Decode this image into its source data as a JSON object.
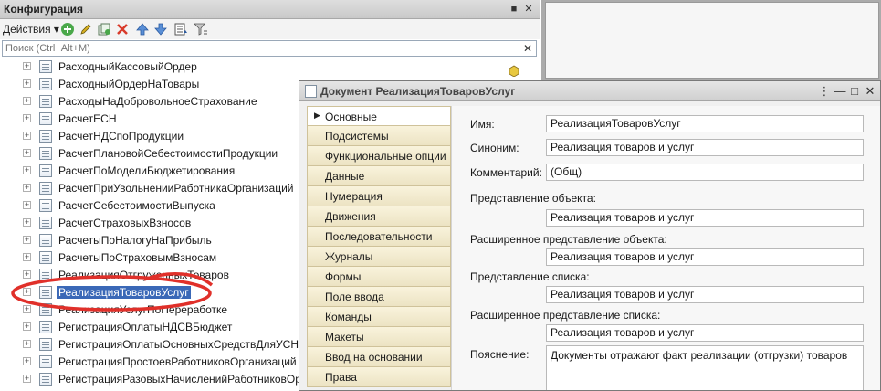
{
  "config_panel": {
    "title": "Конфигурация",
    "pin_icon": "pin-icon",
    "close_icon": "close-icon",
    "toolbar": {
      "actions_label": "Действия",
      "icons": [
        "add-icon",
        "edit-icon",
        "copy-icon",
        "delete-icon",
        "move-up-icon",
        "move-down-icon",
        "sort-icon",
        "filter-icon"
      ]
    },
    "search": {
      "placeholder": "Поиск (Ctrl+Alt+M)"
    },
    "tree_items": [
      "РасходныйКассовыйОрдер",
      "РасходныйОрдерНаТовары",
      "РасходыНаДобровольноеСтрахование",
      "РасчетЕСН",
      "РасчетНДСпоПродукции",
      "РасчетПлановойСебестоимостиПродукции",
      "РасчетПоМоделиБюджетирования",
      "РасчетПриУвольненииРаботникаОрганизаций",
      "РасчетСебестоимостиВыпуска",
      "РасчетСтраховыхВзносов",
      "РасчетыПоНалогуНаПрибыль",
      "РасчетыПоСтраховымВзносам",
      "РеализацияОтгруженныхТоваров",
      "РеализацияТоваровУслуг",
      "РеализацияУслугПоПереработке",
      "РегистрацияОплатыНДСВБюджет",
      "РегистрацияОплатыОсновныхСредствДляУСН",
      "РегистрацияПростоевРаботниковОрганизаций",
      "РегистрацияРазовыхНачисленийРаботниковОрганизаций"
    ],
    "selected_index": 13
  },
  "doc_window": {
    "title": "Документ РеализацияТоваровУслуг",
    "nav_items": [
      "Основные",
      "Подсистемы",
      "Функциональные опции",
      "Данные",
      "Нумерация",
      "Движения",
      "Последовательности",
      "Журналы",
      "Формы",
      "Поле ввода",
      "Команды",
      "Макеты",
      "Ввод на основании",
      "Права"
    ],
    "active_nav": 0,
    "form": {
      "name_label": "Имя:",
      "name_value": "РеализацияТоваровУслуг",
      "synonym_label": "Синоним:",
      "synonym_value": "Реализация товаров и услуг",
      "comment_label": "Комментарий:",
      "comment_value": "(Общ)",
      "object_repr_label": "Представление объекта:",
      "object_repr_value": "Реализация товаров и услуг",
      "ext_object_repr_label": "Расширенное представление объекта:",
      "ext_object_repr_value": "Реализация товаров и услуг",
      "list_repr_label": "Представление списка:",
      "list_repr_value": "Реализация товаров и услуг",
      "ext_list_repr_label": "Расширенное представление списка:",
      "ext_list_repr_value": "Реализация товаров и услуг",
      "explanation_label": "Пояснение:",
      "explanation_value": "Документы отражают факт реализации (отгрузки) товаров"
    }
  },
  "colors": {
    "selection": "#3a68b7",
    "annotation": "#e0302a",
    "nav_bg": "#f3ebcf"
  }
}
